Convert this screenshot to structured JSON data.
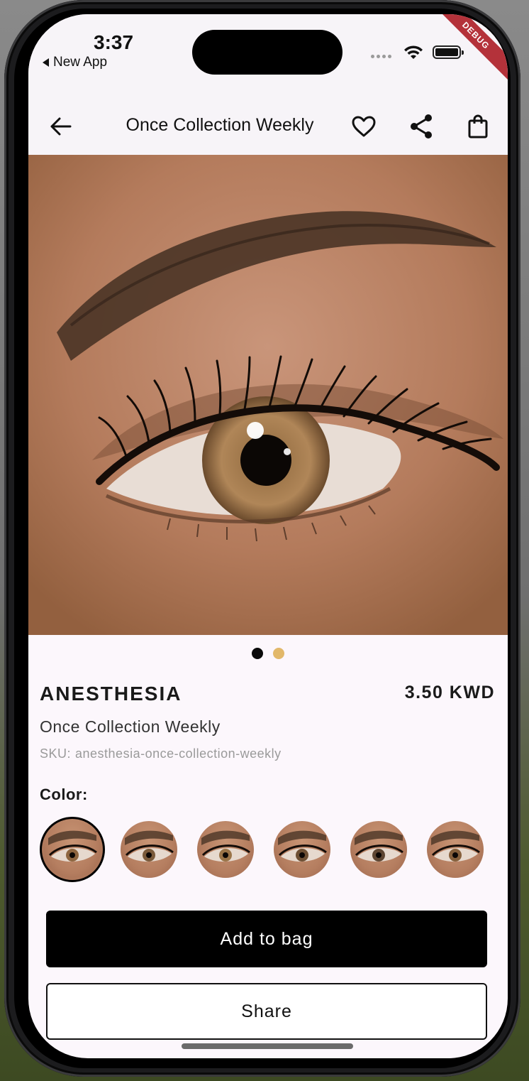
{
  "status_bar": {
    "time": "3:37",
    "back_app": "New App",
    "debug_banner": "DEBUG"
  },
  "app_bar": {
    "title": "Once Collection Weekly",
    "icons": [
      "back-arrow-icon",
      "heart-icon",
      "share-icon",
      "shopping-bag-icon"
    ]
  },
  "gallery": {
    "image": "close-up of an eye wearing a hazel colored contact lens",
    "page_count": 2,
    "current_page": 1,
    "active_dot_color": "#0a0a0a",
    "inactive_dot_color": "#e2b86a"
  },
  "product": {
    "name": "ANESTHESIA",
    "price": "3.50 KWD",
    "collection": "Once Collection Weekly",
    "sku_label": "SKU:",
    "sku_value": "anesthesia-once-collection-weekly",
    "color_label": "Color:",
    "color_option_count": 6,
    "selected_color_index": 0
  },
  "actions": {
    "add_to_bag": "Add to bag",
    "share": "Share"
  },
  "colors": {
    "primary_button": "#000000",
    "background": "#fcf7fc"
  }
}
